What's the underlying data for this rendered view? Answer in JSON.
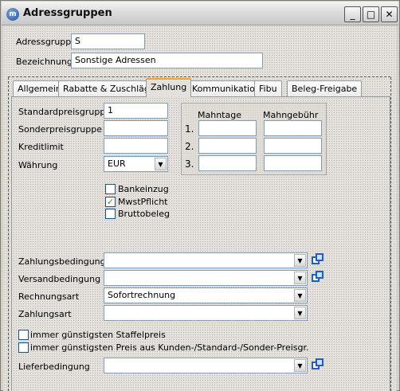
{
  "window": {
    "title": "Adressgruppen",
    "app_icon": "m",
    "minimize": "_",
    "maximize": "□",
    "close": "✕"
  },
  "header": {
    "adressgruppe_label": "Adressgruppe",
    "adressgruppe_value": "S",
    "bezeichnung_label": "Bezeichnung",
    "bezeichnung_value": "Sonstige Adressen"
  },
  "tabs": [
    "Allgemein",
    "Rabatte & Zuschläge",
    "Zahlung",
    "Kommunikation",
    "Fibu",
    "Beleg-Freigabe"
  ],
  "active_tab": "Zahlung",
  "zahlung": {
    "standardpreisgruppe_label": "Standardpreisgruppe",
    "standardpreisgruppe_value": "1",
    "sonderpreisgruppe_label": "Sonderpreisgruppe",
    "sonderpreisgruppe_value": "",
    "kreditlimit_label": "Kreditlimit",
    "kreditlimit_value": "",
    "waehrung_label": "Währung",
    "waehrung_value": "EUR",
    "mahn": {
      "col1": "Mahntage",
      "col2": "Mahngebühr",
      "rows": [
        "1.",
        "2.",
        "3."
      ]
    },
    "checkboxes": [
      {
        "label": "Bankeinzug",
        "checked": false
      },
      {
        "label": "MwstPflicht",
        "checked": true
      },
      {
        "label": "Bruttobeleg",
        "checked": false
      }
    ],
    "zahlungsbedingung_label": "Zahlungsbedingung",
    "zahlungsbedingung_value": "",
    "versandbedingung_label": "Versandbedingung",
    "versandbedingung_value": "",
    "rechnungsart_label": "Rechnungsart",
    "rechnungsart_value": "Sofortrechnung",
    "zahlungsart_label": "Zahlungsart",
    "zahlungsart_value": "",
    "staffelpreis_label": "immer günstigsten Staffelpreis",
    "preis_label": "immer günstigsten Preis aus Kunden-/Standard-/Sonder-Preisgr.",
    "lieferbedingung_label": "Lieferbedingung",
    "lieferbedingung_value": ""
  },
  "icons": {
    "dropdown": "chevron-down-icon",
    "copy": "copy-icon",
    "check": "checkmark-icon"
  },
  "colors": {
    "active_tab_accent": "#f0a030",
    "input_border": "#7f9db9",
    "copy_icon": "#1f5fbf"
  }
}
